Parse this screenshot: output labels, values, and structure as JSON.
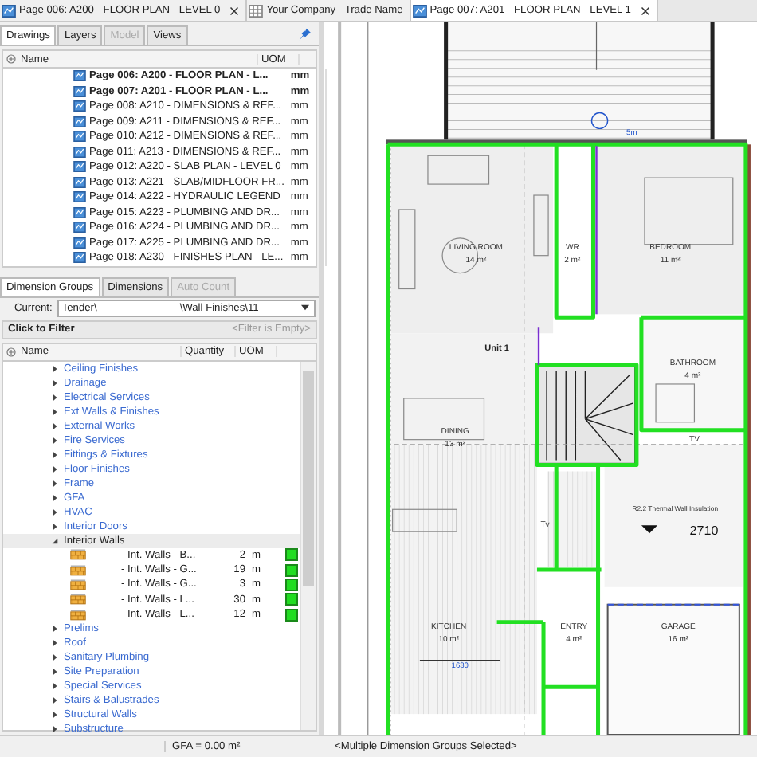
{
  "doc_tabs": [
    {
      "label": "Page 006: A200 - FLOOR PLAN - LEVEL 0",
      "kind": "drawing",
      "selected": false,
      "closable": true
    },
    {
      "label": "Your Company - Trade Name",
      "kind": "table",
      "selected": false,
      "closable": false
    },
    {
      "label": "Page 007: A201 - FLOOR PLAN - LEVEL 1",
      "kind": "drawing",
      "selected": true,
      "closable": true
    }
  ],
  "drawings_panel": {
    "tabs": [
      {
        "label": "Drawings",
        "selected": true,
        "disabled": false
      },
      {
        "label": "Layers",
        "selected": false,
        "disabled": false
      },
      {
        "label": "Model",
        "selected": false,
        "disabled": true
      },
      {
        "label": "Views",
        "selected": false,
        "disabled": false
      }
    ],
    "columns": [
      "Name",
      "UOM"
    ],
    "rows": [
      {
        "name": "Page 006: A200 - FLOOR PLAN - L...",
        "uom": "mm",
        "bold": true
      },
      {
        "name": "Page 007: A201 - FLOOR PLAN - L...",
        "uom": "mm",
        "bold": true
      },
      {
        "name": "Page 008: A210 - DIMENSIONS & REF...",
        "uom": "mm",
        "bold": false
      },
      {
        "name": "Page 009: A211 - DIMENSIONS & REF...",
        "uom": "mm",
        "bold": false
      },
      {
        "name": "Page 010: A212 - DIMENSIONS & REF...",
        "uom": "mm",
        "bold": false
      },
      {
        "name": "Page 011: A213 - DIMENSIONS & REF...",
        "uom": "mm",
        "bold": false
      },
      {
        "name": "Page 012: A220 - SLAB PLAN - LEVEL 0",
        "uom": "mm",
        "bold": false
      },
      {
        "name": "Page 013: A221 - SLAB/MIDFLOOR FR...",
        "uom": "mm",
        "bold": false
      },
      {
        "name": "Page 014: A222 - HYDRAULIC LEGEND",
        "uom": "mm",
        "bold": false
      },
      {
        "name": "Page 015: A223 - PLUMBING AND DR...",
        "uom": "mm",
        "bold": false
      },
      {
        "name": "Page 016: A224 - PLUMBING AND DR...",
        "uom": "mm",
        "bold": false
      },
      {
        "name": "Page 017: A225 - PLUMBING AND DR...",
        "uom": "mm",
        "bold": false
      },
      {
        "name": "Page 018: A230 - FINISHES PLAN - LE...",
        "uom": "mm",
        "bold": false
      }
    ]
  },
  "dimension_panel": {
    "tabs": [
      {
        "label": "Dimension Groups",
        "selected": true,
        "disabled": false
      },
      {
        "label": "Dimensions",
        "selected": false,
        "disabled": false
      },
      {
        "label": "Auto Count",
        "selected": false,
        "disabled": true
      }
    ],
    "current_label": "Current:",
    "current_path": [
      "Tender\\",
      "\\Wall Finishes\\11"
    ],
    "filter_label": "Click to Filter",
    "filter_state": "<Filter is Empty>",
    "columns": [
      "Name",
      "Quantity",
      "UOM"
    ],
    "groups": [
      {
        "name": "Ceiling Finishes",
        "expanded": false,
        "selected": false
      },
      {
        "name": "Drainage",
        "expanded": false,
        "selected": false
      },
      {
        "name": "Electrical Services",
        "expanded": false,
        "selected": false
      },
      {
        "name": "Ext Walls & Finishes",
        "expanded": false,
        "selected": false
      },
      {
        "name": "External Works",
        "expanded": false,
        "selected": false
      },
      {
        "name": "Fire Services",
        "expanded": false,
        "selected": false
      },
      {
        "name": "Fittings & Fixtures",
        "expanded": false,
        "selected": false
      },
      {
        "name": "Floor Finishes",
        "expanded": false,
        "selected": false
      },
      {
        "name": "Frame",
        "expanded": false,
        "selected": false
      },
      {
        "name": "GFA",
        "expanded": false,
        "selected": false
      },
      {
        "name": "HVAC",
        "expanded": false,
        "selected": false
      },
      {
        "name": "Interior Doors",
        "expanded": false,
        "selected": false
      },
      {
        "name": "Interior Walls",
        "expanded": true,
        "selected": true,
        "children": [
          {
            "name": "- Int. Walls - B...",
            "quantity": "2",
            "uom": "m",
            "color": "#22dd22"
          },
          {
            "name": "- Int. Walls - G...",
            "quantity": "19",
            "uom": "m",
            "color": "#22dd22"
          },
          {
            "name": "- Int. Walls - G...",
            "quantity": "3",
            "uom": "m",
            "color": "#22dd22"
          },
          {
            "name": "- Int. Walls - L...",
            "quantity": "30",
            "uom": "m",
            "color": "#22dd22"
          },
          {
            "name": "- Int. Walls - L...",
            "quantity": "12",
            "uom": "m",
            "color": "#22dd22"
          }
        ]
      },
      {
        "name": "Prelims",
        "expanded": false,
        "selected": false
      },
      {
        "name": "Roof",
        "expanded": false,
        "selected": false
      },
      {
        "name": "Sanitary Plumbing",
        "expanded": false,
        "selected": false
      },
      {
        "name": "Site Preparation",
        "expanded": false,
        "selected": false
      },
      {
        "name": "Special Services",
        "expanded": false,
        "selected": false
      },
      {
        "name": "Stairs & Balustrades",
        "expanded": false,
        "selected": false
      },
      {
        "name": "Structural Walls",
        "expanded": false,
        "selected": false
      },
      {
        "name": "Substructure",
        "expanded": false,
        "selected": false
      }
    ]
  },
  "plan_labels": [
    {
      "text": "5m",
      "kind": "dimension"
    },
    {
      "text": "LIVING ROOM",
      "kind": "room"
    },
    {
      "text": "14 m²",
      "kind": "area"
    },
    {
      "text": "WR",
      "kind": "room"
    },
    {
      "text": "2 m²",
      "kind": "area"
    },
    {
      "text": "BEDROOM",
      "kind": "room"
    },
    {
      "text": "11 m²",
      "kind": "area"
    },
    {
      "text": "Unit 1",
      "kind": "unit"
    },
    {
      "text": "BATHROOM",
      "kind": "room"
    },
    {
      "text": "4 m²",
      "kind": "area"
    },
    {
      "text": "DINING",
      "kind": "room"
    },
    {
      "text": "13 m²",
      "kind": "area"
    },
    {
      "text": "TV",
      "kind": "room"
    },
    {
      "text": "R2.2 Thermal Wall Insulation",
      "kind": "note"
    },
    {
      "text": "2710",
      "kind": "level"
    },
    {
      "text": "Tv",
      "kind": "room"
    },
    {
      "text": "KITCHEN",
      "kind": "room"
    },
    {
      "text": "10 m²",
      "kind": "area"
    },
    {
      "text": "ENTRY",
      "kind": "room"
    },
    {
      "text": "4 m²",
      "kind": "area"
    },
    {
      "text": "GARAGE",
      "kind": "room"
    },
    {
      "text": "16 m²",
      "kind": "area"
    },
    {
      "text": "1630",
      "kind": "dimension"
    }
  ],
  "status_bar": [
    "GFA = 0.00 m²",
    "<Multiple Dimension Groups Selected>"
  ]
}
